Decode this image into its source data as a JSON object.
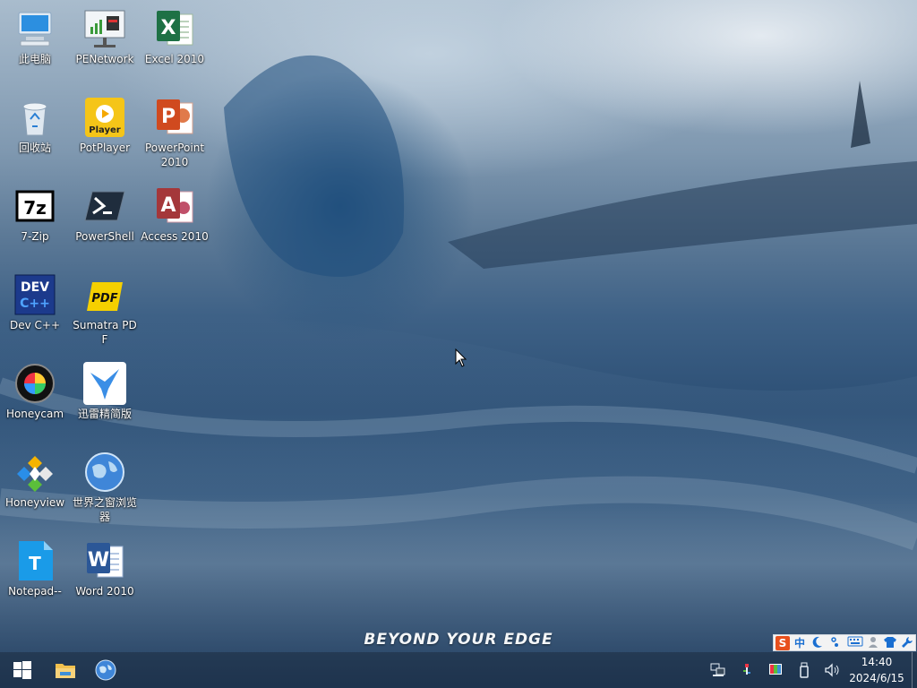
{
  "desktop": {
    "icons": [
      {
        "label": "此电脑",
        "icon": "computer-icon"
      },
      {
        "label": "PENetwork",
        "icon": "network-monitor-icon"
      },
      {
        "label": "Excel 2010",
        "icon": "excel-icon"
      },
      {
        "label": "回收站",
        "icon": "recycle-bin-icon"
      },
      {
        "label": "PotPlayer",
        "icon": "potplayer-icon"
      },
      {
        "label": "PowerPoint 2010",
        "icon": "powerpoint-icon"
      },
      {
        "label": "7-Zip",
        "icon": "7zip-icon"
      },
      {
        "label": "PowerShell",
        "icon": "powershell-icon"
      },
      {
        "label": "Access 2010",
        "icon": "access-icon"
      },
      {
        "label": "Dev C++",
        "icon": "devcpp-icon"
      },
      {
        "label": "Sumatra PDF",
        "icon": "sumatra-pdf-icon"
      },
      {
        "label": "Honeycam",
        "icon": "honeycam-icon"
      },
      {
        "label": "迅雷精简版",
        "icon": "xunlei-icon"
      },
      {
        "label": "Honeyview",
        "icon": "honeyview-icon"
      },
      {
        "label": "世界之窗浏览器",
        "icon": "globe-browser-icon"
      },
      {
        "label": "Notepad--",
        "icon": "notepad-icon"
      },
      {
        "label": "Word 2010",
        "icon": "word-icon"
      }
    ],
    "slogan": "BEYOND YOUR EDGE"
  },
  "taskbar": {
    "start_icon": "windows-start-icon",
    "pinned": [
      {
        "icon": "file-explorer-icon"
      },
      {
        "icon": "browser-globe-icon"
      }
    ],
    "tray": [
      {
        "icon": "network-tray-icon"
      },
      {
        "icon": "usb-tray-icon"
      },
      {
        "icon": "display-tray-icon"
      },
      {
        "icon": "removable-drive-icon"
      },
      {
        "icon": "volume-icon"
      }
    ],
    "clock": {
      "time": "14:40",
      "date": "2024/6/15"
    }
  },
  "ime_bar": {
    "logo": "S",
    "mode": "中",
    "items": [
      "moon-icon",
      "punctuation-icon",
      "keyboard-icon",
      "user-icon",
      "skin-icon",
      "wrench-icon"
    ]
  },
  "colors": {
    "excel": "#1e7145",
    "powerpoint": "#d04a1f",
    "access": "#a4373a",
    "word": "#2b5797",
    "potplayer": "#f5c518",
    "sogou": "#e8501d"
  }
}
